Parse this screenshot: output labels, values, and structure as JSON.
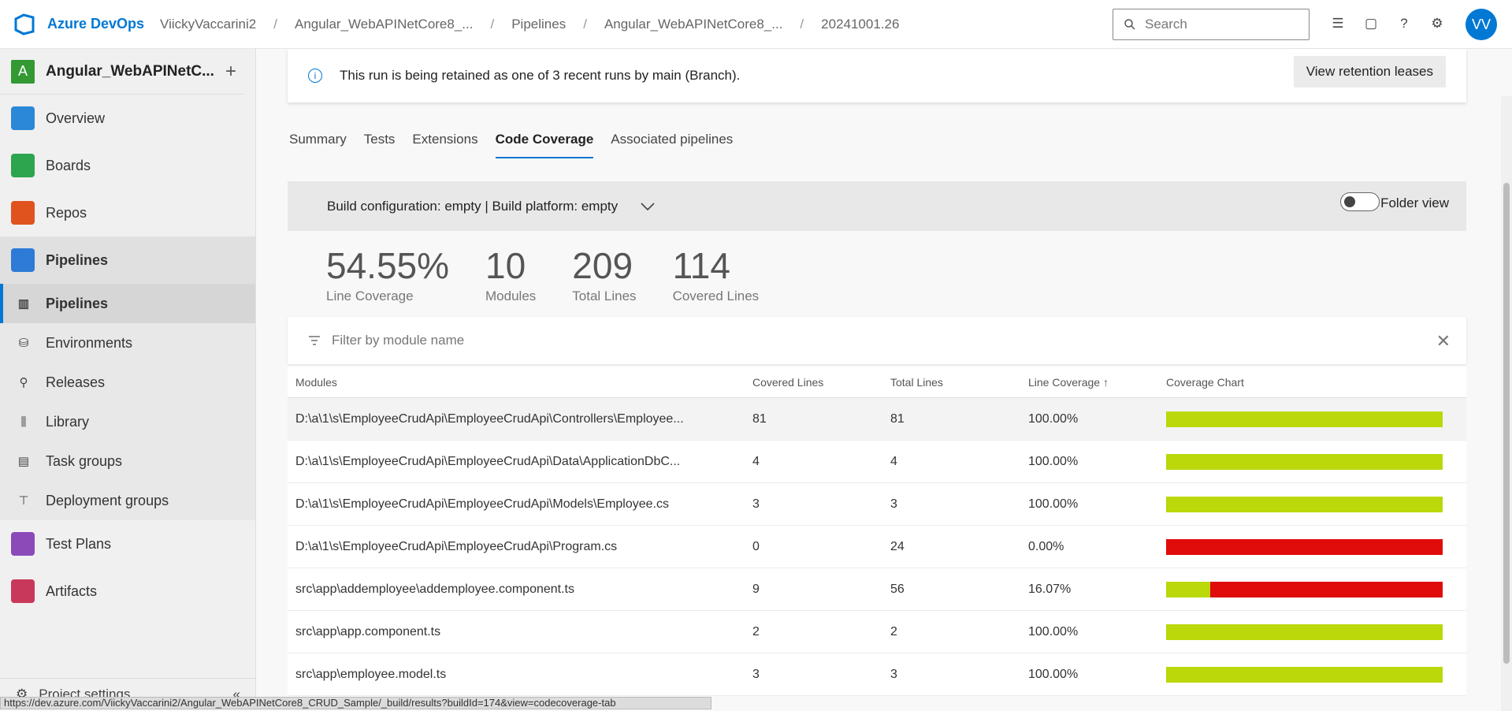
{
  "header": {
    "brand": "Azure DevOps",
    "breadcrumbs": [
      "ViickyVaccarini2",
      "Angular_WebAPINetCore8_...",
      "Pipelines",
      "Angular_WebAPINetCore8_...",
      "20241001.26"
    ],
    "search_placeholder": "Search",
    "avatar_initials": "VV"
  },
  "sidebar": {
    "project_badge": "A",
    "project_name": "Angular_WebAPINetC...",
    "items": [
      {
        "label": "Overview"
      },
      {
        "label": "Boards"
      },
      {
        "label": "Repos"
      },
      {
        "label": "Pipelines"
      }
    ],
    "sub_items": [
      {
        "label": "Pipelines"
      },
      {
        "label": "Environments"
      },
      {
        "label": "Releases"
      },
      {
        "label": "Library"
      },
      {
        "label": "Task groups"
      },
      {
        "label": "Deployment groups"
      }
    ],
    "bottom_items": [
      {
        "label": "Test Plans"
      },
      {
        "label": "Artifacts"
      }
    ],
    "settings_label": "Project settings",
    "status_url": "https://dev.azure.com/ViickyVaccarini2/Angular_WebAPINetCore8_CRUD_Sample/_build/results?buildId=174&view=codecoverage-tab"
  },
  "banner": {
    "message": "This run is being retained as one of 3 recent runs by main (Branch).",
    "button": "View retention leases"
  },
  "tabs": [
    "Summary",
    "Tests",
    "Extensions",
    "Code Coverage",
    "Associated pipelines"
  ],
  "config": {
    "text": "Build configuration: empty | Build platform: empty",
    "folder_view": "Folder view"
  },
  "stats": [
    {
      "value": "54.55%",
      "label": "Line Coverage"
    },
    {
      "value": "10",
      "label": "Modules"
    },
    {
      "value": "209",
      "label": "Total Lines"
    },
    {
      "value": "114",
      "label": "Covered Lines"
    }
  ],
  "filter_placeholder": "Filter by module name",
  "table": {
    "headers": [
      "Modules",
      "Covered Lines",
      "Total Lines",
      "Line Coverage",
      "Coverage Chart"
    ],
    "rows": [
      {
        "module": "D:\\a\\1\\s\\EmployeeCrudApi\\EmployeeCrudApi\\Controllers\\Employee...",
        "covered": "81",
        "total": "81",
        "coverage": "100.00%",
        "fraction": 1.0
      },
      {
        "module": "D:\\a\\1\\s\\EmployeeCrudApi\\EmployeeCrudApi\\Data\\ApplicationDbC...",
        "covered": "4",
        "total": "4",
        "coverage": "100.00%",
        "fraction": 1.0
      },
      {
        "module": "D:\\a\\1\\s\\EmployeeCrudApi\\EmployeeCrudApi\\Models\\Employee.cs",
        "covered": "3",
        "total": "3",
        "coverage": "100.00%",
        "fraction": 1.0
      },
      {
        "module": "D:\\a\\1\\s\\EmployeeCrudApi\\EmployeeCrudApi\\Program.cs",
        "covered": "0",
        "total": "24",
        "coverage": "0.00%",
        "fraction": 0.0
      },
      {
        "module": "src\\app\\addemployee\\addemployee.component.ts",
        "covered": "9",
        "total": "56",
        "coverage": "16.07%",
        "fraction": 0.1607
      },
      {
        "module": "src\\app\\app.component.ts",
        "covered": "2",
        "total": "2",
        "coverage": "100.00%",
        "fraction": 1.0
      },
      {
        "module": "src\\app\\employee.model.ts",
        "covered": "3",
        "total": "3",
        "coverage": "100.00%",
        "fraction": 1.0
      }
    ]
  },
  "colors": {
    "covered": "#bad80a",
    "uncovered": "#e00b0b",
    "accent": "#0078d4"
  }
}
